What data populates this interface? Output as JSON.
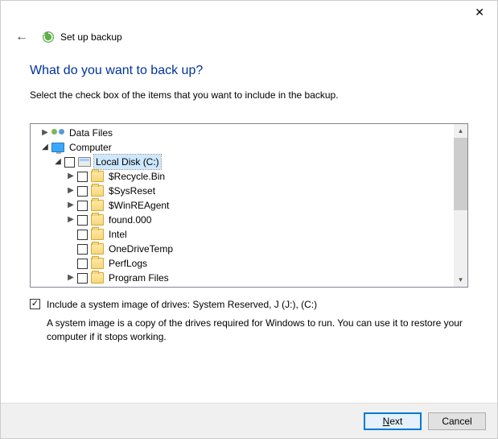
{
  "window": {
    "title": "Set up backup"
  },
  "page": {
    "heading": "What do you want to back up?",
    "instruction": "Select the check box of the items that you want to include in the backup."
  },
  "tree": {
    "data_files": "Data Files",
    "computer": "Computer",
    "local_disk": "Local Disk (C:)",
    "items": [
      "$Recycle.Bin",
      "$SysReset",
      "$WinREAgent",
      "found.000",
      "Intel",
      "OneDriveTemp",
      "PerfLogs",
      "Program Files"
    ]
  },
  "system_image": {
    "label": "Include a system image of drives: System Reserved, J (J:), (C:)",
    "description": "A system image is a copy of the drives required for Windows to run. You can use it to restore your computer if it stops working.",
    "checked": true
  },
  "buttons": {
    "next": "Next",
    "cancel": "Cancel"
  }
}
